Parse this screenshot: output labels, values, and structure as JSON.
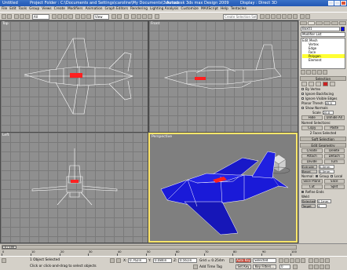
{
  "window": {
    "doc_name": "Untitled",
    "project_folder": "Project Folder : C:\\Documents and Settings\\caroline\\My Documents\\3dsmax",
    "app_title": "Autodesk 3ds max Design 2009",
    "display": "Display : Direct 3D"
  },
  "menu": [
    "File",
    "Edit",
    "Tools",
    "Group",
    "Views",
    "Create",
    "Modifiers",
    "Animation",
    "Graph Editors",
    "Rendering",
    "Lighting Analysis",
    "Customize",
    "MAXScript",
    "Help",
    "Tentacles"
  ],
  "toolbar": {
    "filter_value": "All",
    "refcoord_value": "View",
    "selection_set_placeholder": "Create Selection Set"
  },
  "viewports": {
    "top_left": "Top",
    "top_right": "Front",
    "bottom_left": "Left",
    "bottom_right": "Perspective"
  },
  "command_panel": {
    "object_name": "Box01",
    "modifier_list": "Modifier List",
    "stack": [
      {
        "label": "Edit Mesh",
        "level": 0,
        "selected": false
      },
      {
        "label": "Vertex",
        "level": 1,
        "selected": false
      },
      {
        "label": "Edge",
        "level": 1,
        "selected": false
      },
      {
        "label": "Face",
        "level": 1,
        "selected": false
      },
      {
        "label": "Polygon",
        "level": 1,
        "selected": true
      },
      {
        "label": "Element",
        "level": 1,
        "selected": false
      }
    ],
    "selection_rollout": "Selection",
    "by_vertex": "By Vertex",
    "ignore_backfacing": "Ignore Backfacing",
    "ignore_visible_edges": "Ignore Visible Edges",
    "planar_thresh_label": "Planar Thresh",
    "planar_thresh_value": "45.0",
    "show_normals": "Show Normals",
    "scale_label": "Scale",
    "scale_value": "20.0",
    "hide_label": "Hide",
    "unhide_all_label": "Unhide All",
    "named_selections": "Named Selections:",
    "copy_label": "Copy",
    "paste_label": "Paste",
    "faces_selected": "2 Faces Selected",
    "soft_selection": "Soft Selection",
    "edit_geometry": "Edit Geometry",
    "create_label": "Create",
    "delete_label": "Delete",
    "attach_label": "Attach",
    "detach_label": "Detach",
    "divide_label": "Divide",
    "turn_label": "Turn",
    "extrude_label": "Extrude",
    "extrude_value": "0.0mm",
    "bevel_label": "Bevel",
    "bevel_value": "0.0mm",
    "normal_label": "Normal:",
    "group_label": "Group",
    "local_label": "Local",
    "slice_plane_label": "Slice Plane",
    "slice_label": "Slice",
    "cut_label": "Cut",
    "split_label": "Split",
    "refine_ends_label": "Refine Ends",
    "weld_label": "Weld",
    "selected_label": "Selected",
    "selected_value": "0.1mm",
    "target_label": "Target",
    "target_value": "4"
  },
  "timeline": {
    "frame_display": "0 / 100",
    "ticks": [
      "0",
      "10",
      "20",
      "30",
      "40",
      "50",
      "60",
      "70",
      "80",
      "90",
      "100"
    ]
  },
  "status": {
    "object_selected": "1 Object Selected",
    "prompt": "Click or click-and-drag to select objects",
    "x_label": "X:",
    "x_value": "0.762in",
    "y_label": "Y:",
    "y_value": "0.084in",
    "z_label": "Z:",
    "z_value": "0.561in",
    "grid": "Grid = 0.254m",
    "add_time_tag": "Add Time Tag",
    "auto_key": "Auto Key",
    "set_key": "Set Key",
    "key_filter_value": "Selected",
    "key_filters": "Key Filters...",
    "frame_value": "0"
  },
  "colors": {
    "wireframe": "#ffffff",
    "selected_face": "#ff2020",
    "shaded_mesh": "#1a1ad8",
    "active_viewport_border": "#ffe66a",
    "stack_selected": "#ffff33"
  }
}
